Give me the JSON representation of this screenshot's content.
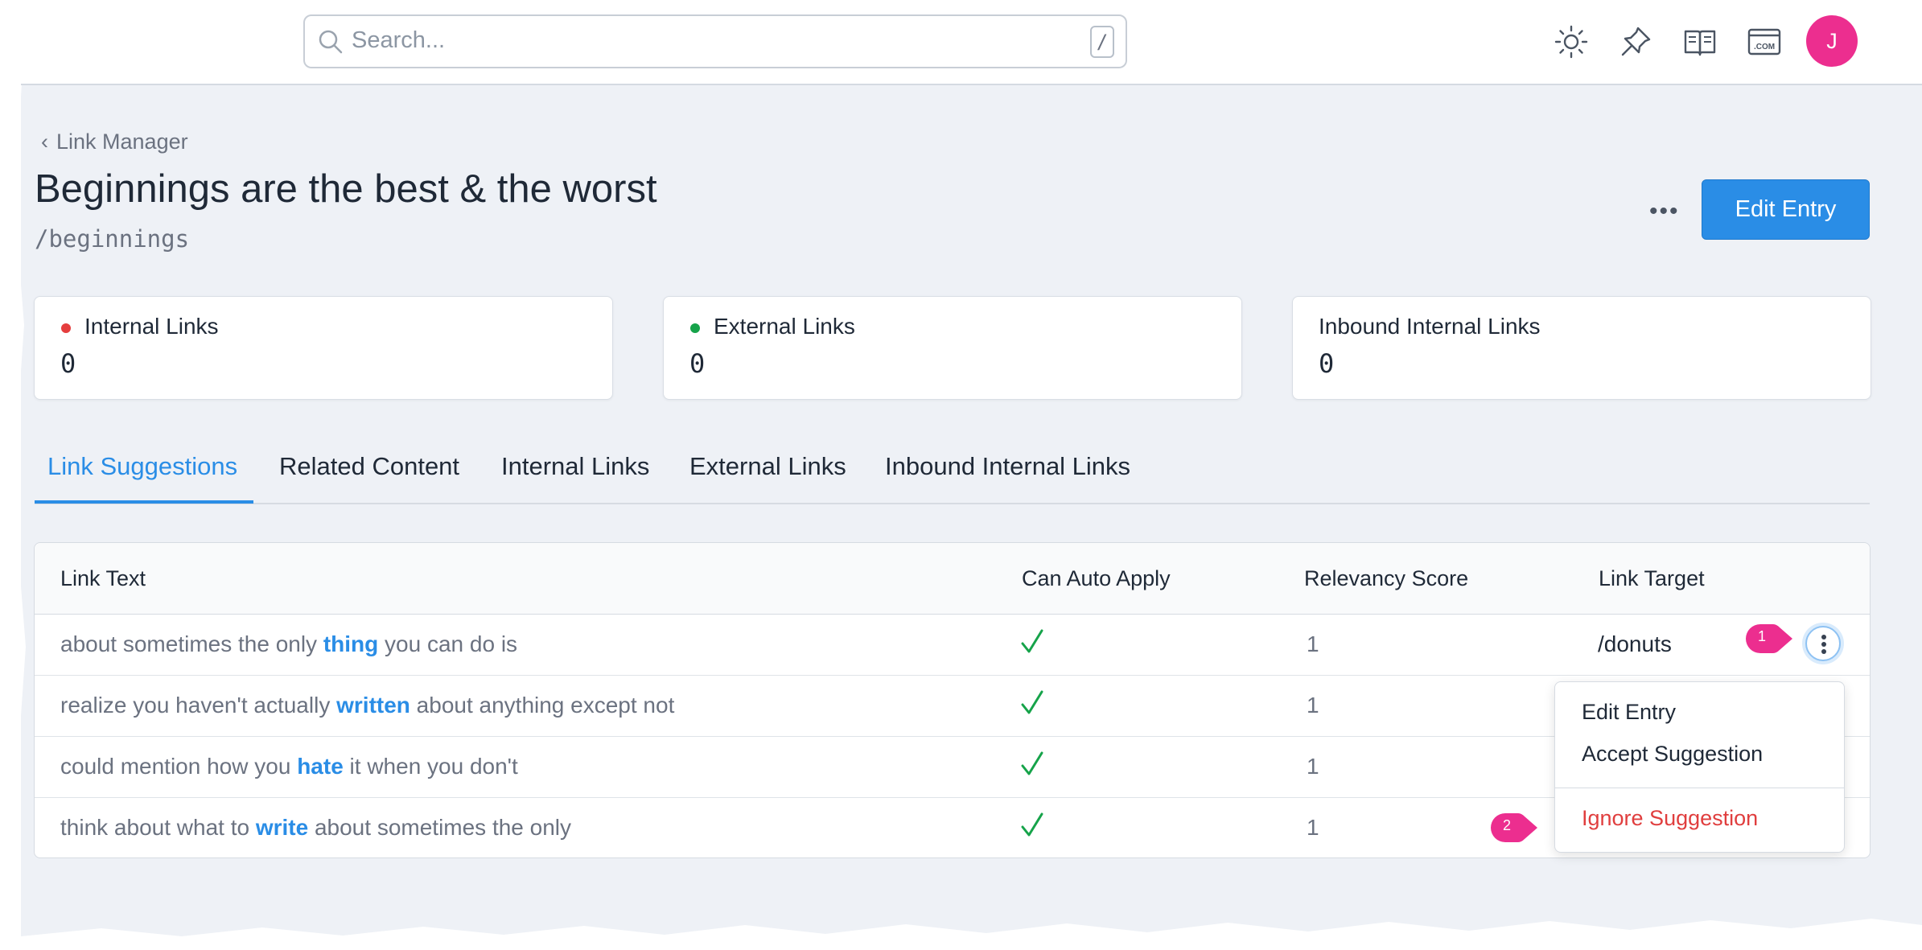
{
  "search": {
    "placeholder": "Search...",
    "shortcut": "/"
  },
  "toolbar": {
    "icons": [
      "sun-icon",
      "pin-icon",
      "book-icon",
      "domain-icon"
    ],
    "avatar_initial": "J",
    "avatar_color": "#ec2e8f"
  },
  "page": {
    "back_label": "Link Manager",
    "title": "Beginnings are the best & the worst",
    "slug": "/beginnings",
    "more_label": "•••",
    "edit_button": "Edit Entry"
  },
  "stats": [
    {
      "label": "Internal Links",
      "value": "0",
      "dot_color": "#e53e3e"
    },
    {
      "label": "External Links",
      "value": "0",
      "dot_color": "#16a34a"
    },
    {
      "label": "Inbound Internal Links",
      "value": "0"
    }
  ],
  "tabs": [
    {
      "label": "Link Suggestions",
      "active": true
    },
    {
      "label": "Related Content"
    },
    {
      "label": "Internal Links"
    },
    {
      "label": "External Links"
    },
    {
      "label": "Inbound Internal Links"
    }
  ],
  "table": {
    "headers": [
      "Link Text",
      "Can Auto Apply",
      "Relevancy Score",
      "Link Target"
    ],
    "rows": [
      {
        "before": "about sometimes the only ",
        "keyword": "thing",
        "after": " you can do is",
        "auto_apply": true,
        "score": "1",
        "target": "/donuts"
      },
      {
        "before": "realize you haven't actually ",
        "keyword": "written",
        "after": " about anything except not",
        "auto_apply": true,
        "score": "1",
        "target": ""
      },
      {
        "before": "could mention how you ",
        "keyword": "hate",
        "after": " it when you don't",
        "auto_apply": true,
        "score": "1",
        "target": ""
      },
      {
        "before": "think about what to ",
        "keyword": "write",
        "after": " about sometimes the only",
        "auto_apply": true,
        "score": "1",
        "target": ""
      }
    ]
  },
  "dropdown": {
    "items": [
      "Edit Entry",
      "Accept Suggestion"
    ],
    "danger_item": "Ignore Suggestion"
  },
  "markers": [
    "1",
    "2"
  ],
  "colors": {
    "accent": "#2a8de6",
    "danger": "#e03e3e",
    "check": "#16a34a",
    "marker": "#ec2e8f"
  }
}
